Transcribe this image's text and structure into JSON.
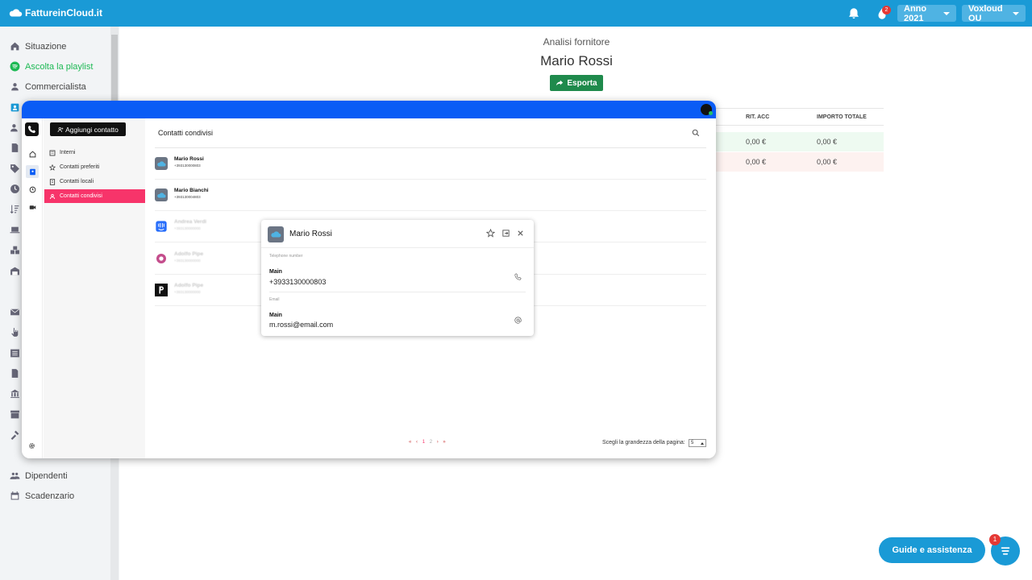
{
  "topbar": {
    "logo": "FattureinCloud.it",
    "notification_badge": "2",
    "year_label": "Anno 2021",
    "company_label": "Voxloud OU"
  },
  "sidebar": {
    "items": [
      {
        "label": "Situazione",
        "icon": "home-icon"
      },
      {
        "label": "Ascolta la playlist",
        "icon": "spotify-icon",
        "color": "#1db954"
      },
      {
        "label": "Commercialista",
        "icon": "user-icon"
      },
      {
        "label": "Dipendenti",
        "icon": "users-icon"
      },
      {
        "label": "Scadenzario",
        "icon": "calendar-icon"
      }
    ]
  },
  "background": {
    "subtitle": "Analisi fornitore",
    "title": "Mario Rossi",
    "export_label": "Esporta",
    "table": {
      "headers": [
        "RIT. ACC",
        "IMPORTO TOTALE"
      ],
      "rows": [
        {
          "rit_acc": "0,00 €",
          "importo_totale": "0,00 €",
          "color": "#eefaf1"
        },
        {
          "rit_acc": "0,00 €",
          "importo_totale": "0,00 €",
          "color": "#fdf2f0"
        }
      ]
    }
  },
  "help": {
    "label": "Guide e assistenza",
    "chat_badge": "1"
  },
  "window": {
    "add_contact_label": "Aggiungi contatto",
    "nav": [
      {
        "label": "Interni",
        "icon": "building-icon"
      },
      {
        "label": "Contatti preferiti",
        "icon": "star-icon"
      },
      {
        "label": "Contatti locali",
        "icon": "phonebook-icon"
      },
      {
        "label": "Contatti condivisi",
        "icon": "shared-user-icon",
        "active": true
      }
    ],
    "content_title": "Contatti condivisi",
    "contacts": [
      {
        "name": "Mario Rossi",
        "phone": "+393130000803",
        "avatar": "cloud-avatar"
      },
      {
        "name": "Mario Bianchi",
        "phone": "+393130004803",
        "avatar": "cloud-avatar"
      },
      {
        "name": "Andrea Verdi",
        "phone": "+393130000000",
        "avatar": "intercom-avatar"
      },
      {
        "name": "Adolfo Pipe",
        "phone": "+393130000000",
        "avatar": "donut-avatar"
      },
      {
        "name": "Adolfo Pipe",
        "phone": "+393130000000",
        "avatar": "p-avatar"
      }
    ],
    "pager": {
      "first": "«",
      "prev": "‹",
      "pages": [
        "1",
        "2"
      ],
      "next": "›",
      "last": "»"
    },
    "page_size_label": "Scegli la grandezza della pagina:",
    "page_size_value": "5"
  },
  "popup": {
    "name": "Mario Rossi",
    "phone_section": "Telephone number",
    "phone_label": "Main",
    "phone_value": "+3933130000803",
    "email_section": "Email",
    "email_label": "Main",
    "email_value": "m.rossi@email.com"
  }
}
